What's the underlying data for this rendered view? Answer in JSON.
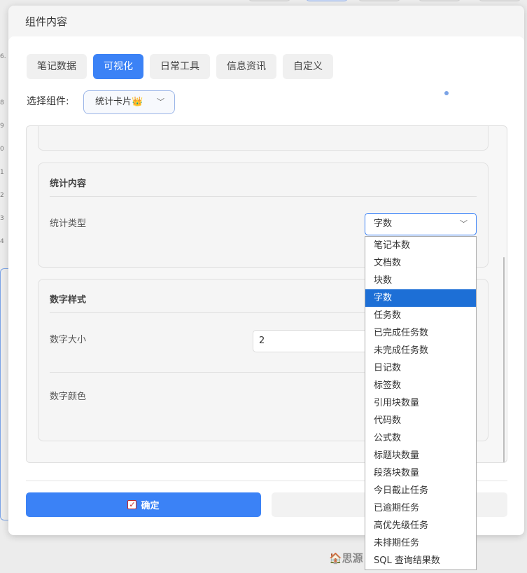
{
  "background": {
    "gutter_numbers": [
      "6.",
      "8",
      "9",
      "0",
      "1",
      "2",
      "3",
      "4"
    ],
    "footer_brand": "🏠思源"
  },
  "dialog": {
    "title": "组件内容",
    "tabs": [
      {
        "label": "笔记数据",
        "active": false
      },
      {
        "label": "可视化",
        "active": true
      },
      {
        "label": "日常工具",
        "active": false
      },
      {
        "label": "信息资讯",
        "active": false
      },
      {
        "label": "自定义",
        "active": false
      }
    ],
    "component_label": "选择组件:",
    "component_value": "统计卡片👑",
    "stat_section": {
      "title": "统计内容",
      "type_label": "统计类型",
      "type_value": "字数"
    },
    "number_section": {
      "title": "数字样式",
      "size_label": "数字大小",
      "size_value": "2",
      "color_label": "数字颜色"
    },
    "confirm_label": "确定",
    "accent_color": "#3b82f6"
  },
  "dropdown": {
    "selected_index": 3,
    "options": [
      "笔记本数",
      "文档数",
      "块数",
      "字数",
      "任务数",
      "已完成任务数",
      "未完成任务数",
      "日记数",
      "标签数",
      "引用块数量",
      "代码数",
      "公式数",
      "标题块数量",
      "段落块数量",
      "今日截止任务",
      "已逾期任务",
      "高优先级任务",
      "未排期任务",
      "SQL 查询结果数"
    ]
  }
}
